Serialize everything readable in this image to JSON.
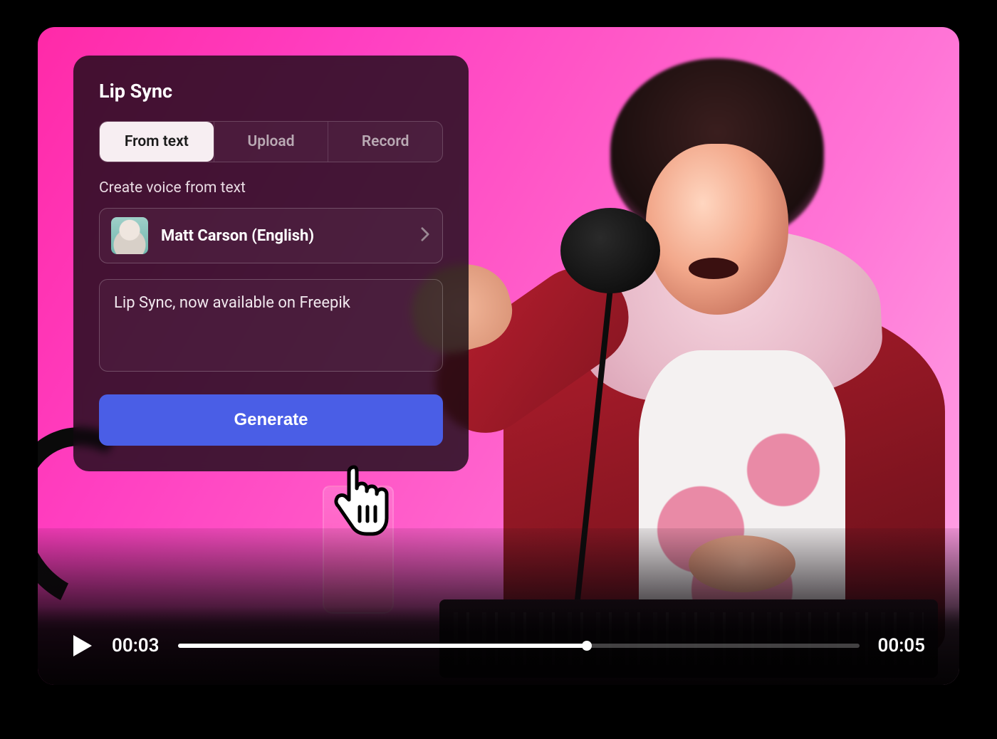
{
  "panel": {
    "title": "Lip Sync",
    "tabs": [
      {
        "label": "From text",
        "active": true
      },
      {
        "label": "Upload",
        "active": false
      },
      {
        "label": "Record",
        "active": false
      }
    ],
    "section_label": "Create voice from text",
    "voice": {
      "name": "Matt Carson (English)"
    },
    "text_value": "Lip Sync, now available on Freepik",
    "generate_label": "Generate"
  },
  "player": {
    "current_time": "00:03",
    "duration": "00:05",
    "progress_percent": 60
  }
}
